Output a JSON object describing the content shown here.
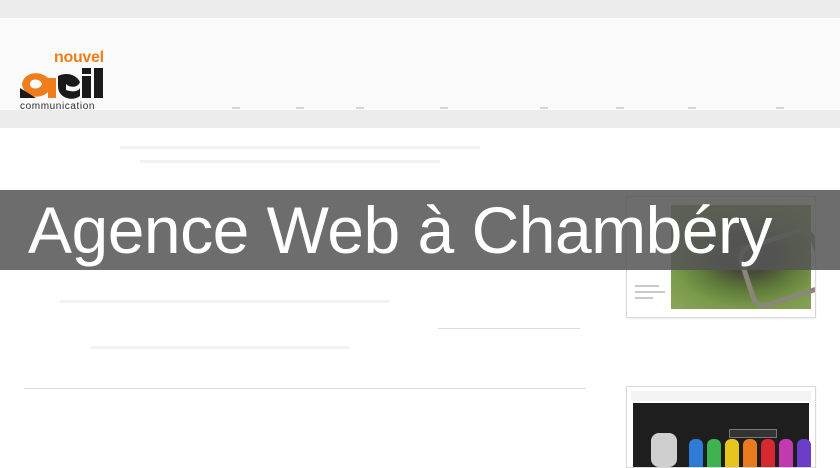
{
  "brand": {
    "name_top": "nouvel",
    "name_bottom": "communication",
    "accent_color": "#ee7d1a"
  },
  "banner": {
    "title": "Agence Web à Chambéry"
  },
  "icons": [
    "logo-mark-icon"
  ]
}
